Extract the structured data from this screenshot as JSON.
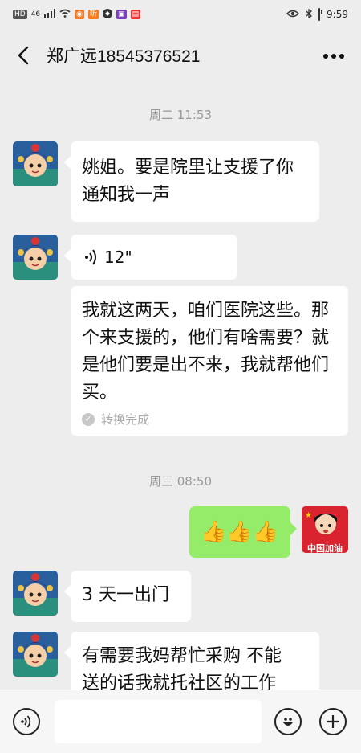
{
  "status": {
    "time": "9:59",
    "chips": [
      "HD",
      "46",
      "听"
    ]
  },
  "header": {
    "title": "郑广远18545376521"
  },
  "chat": {
    "timestamps": [
      "周二 11:53",
      "周三 08:50"
    ],
    "messages": {
      "m1": "姚姐。要是院里让支援了你通知我一声",
      "voice_duration": "12\"",
      "m3": "我就这两天，咱们医院这些。那个来支援的，他们有啥需要？就是他们要是出不来，我就帮他们买。",
      "converted_label": "转换完成",
      "m4_emoji": "👍👍👍",
      "m5": "3 天一出门",
      "m6_line1": "有需要我妈帮忙采购 不能",
      "m6_line2": "送的话我就托社区的工作"
    },
    "my_avatar_label": "中国加油"
  },
  "input": {
    "placeholder": ""
  },
  "colors": {
    "sent_bubble": "#95ec69",
    "background": "#ededed"
  }
}
